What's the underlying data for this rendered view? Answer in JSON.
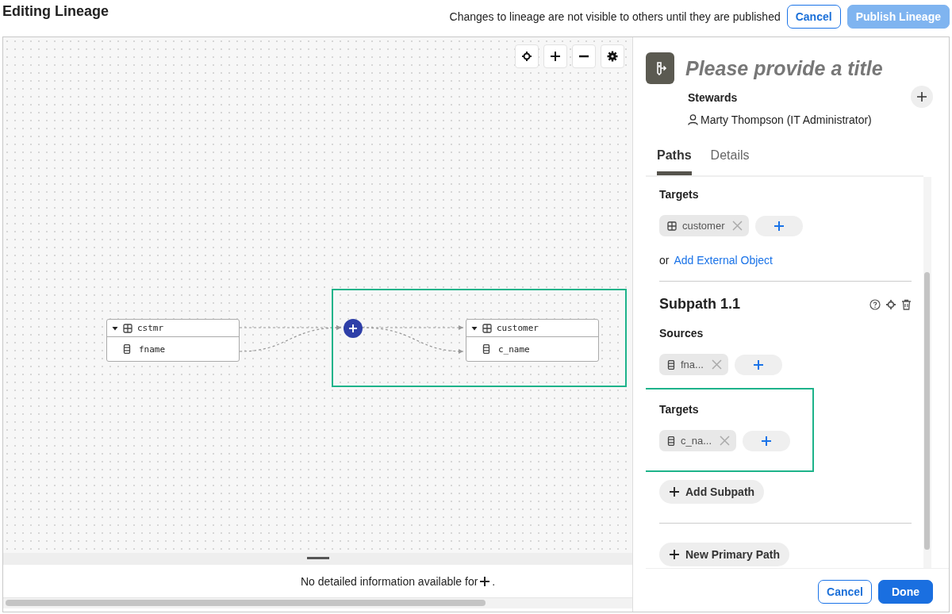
{
  "header": {
    "title": "Editing Lineage",
    "notice": "Changes to lineage are not visible to others until they are published",
    "buttons": [
      {
        "label": "Cancel",
        "kind": "outline",
        "disabled": false
      },
      {
        "label": "Publish Lineage",
        "kind": "primary",
        "disabled": true
      }
    ]
  },
  "canvas": {
    "nodes": [
      {
        "name": "cstmr",
        "expanded": true,
        "columns": [
          "fname"
        ]
      },
      {
        "name": "customer",
        "expanded": true,
        "columns": [
          "c_name"
        ]
      }
    ],
    "info": {
      "text": "No detailed information available for",
      "suffix": "."
    }
  },
  "panel": {
    "title_placeholder": "Please provide a title",
    "stewards_label": "Stewards",
    "stewards": [
      "Marty Thompson (IT Administrator)"
    ],
    "tabs": [
      {
        "label": "Paths",
        "selected": true
      },
      {
        "label": "Details",
        "selected": false
      }
    ],
    "targets": {
      "label": "Targets",
      "chips": [
        {
          "label": "customer",
          "kind": "table"
        }
      ],
      "or": "or",
      "link": "Add External Object"
    },
    "subpath": {
      "title": "Subpath 1.1",
      "sections": [
        {
          "label": "Sources",
          "highlighted": false,
          "chips": [
            {
              "label": "fna...",
              "kind": "column"
            }
          ]
        },
        {
          "label": "Targets",
          "highlighted": true,
          "chips": [
            {
              "label": "c_na...",
              "kind": "column"
            }
          ]
        }
      ],
      "add_label": "Add Subpath"
    },
    "new_path_label": "New Primary Path",
    "footer": [
      {
        "label": "Cancel",
        "kind": "outline"
      },
      {
        "label": "Done",
        "kind": "primary"
      }
    ]
  }
}
